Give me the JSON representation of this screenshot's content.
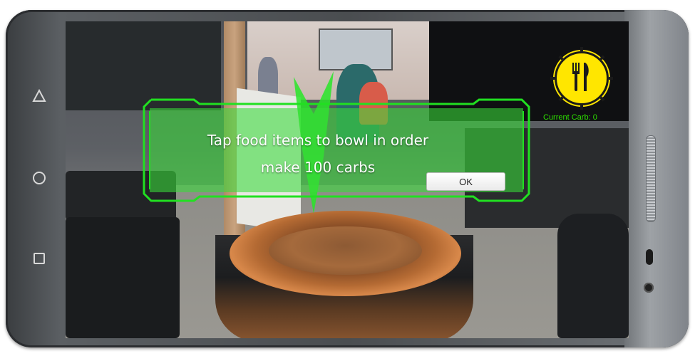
{
  "device": {
    "nav_back_icon": "back-triangle-icon",
    "nav_home_icon": "home-circle-icon",
    "nav_recent_icon": "recent-square-icon"
  },
  "hud": {
    "plate_icon": "fork-knife-icon",
    "plate_color": "#ffe600",
    "current_carb_label": "Current Carb: 0",
    "label_color": "#2de000"
  },
  "dialog": {
    "line1": "Tap food items to bowl in order",
    "line2": "make 100 carbs",
    "ok_label": "OK",
    "fill_color": "#38dc38",
    "border_color": "#21e021"
  }
}
